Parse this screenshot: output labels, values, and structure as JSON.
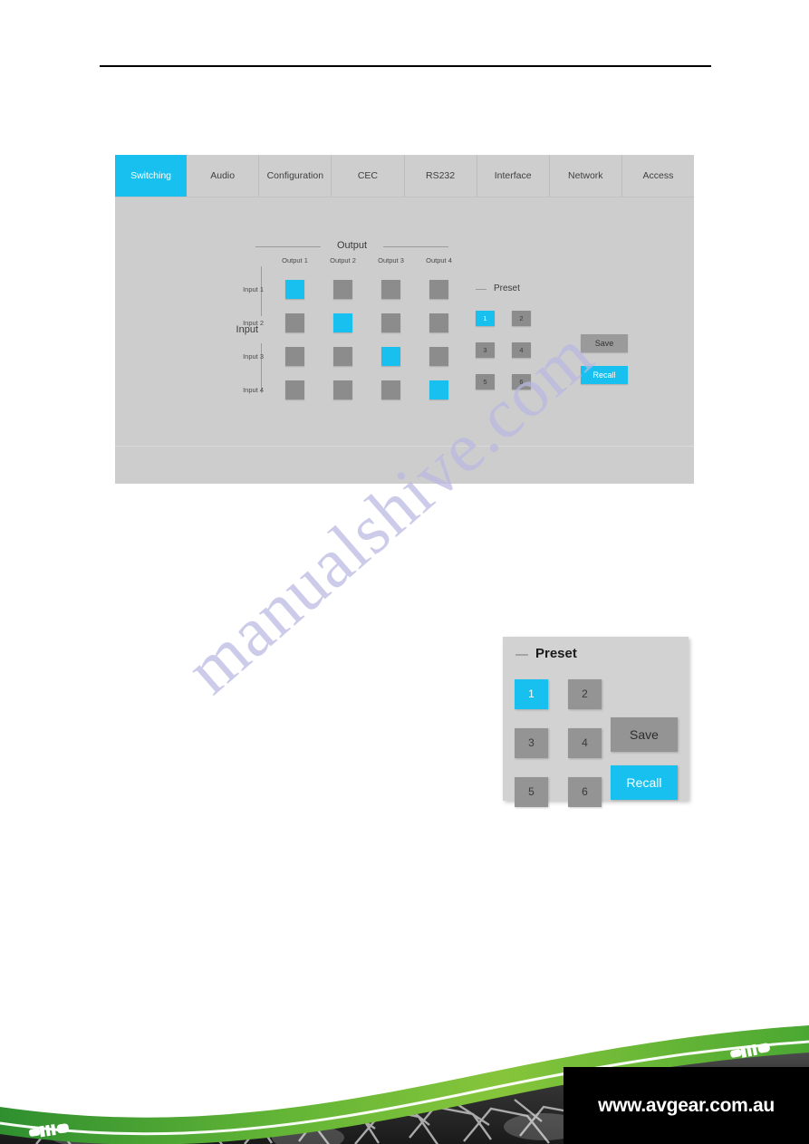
{
  "matrix_ui": {
    "tabs": [
      {
        "label": "Switching",
        "active": true
      },
      {
        "label": "Audio",
        "active": false
      },
      {
        "label": "Configuration",
        "active": false
      },
      {
        "label": "CEC",
        "active": false
      },
      {
        "label": "RS232",
        "active": false
      },
      {
        "label": "Interface",
        "active": false
      },
      {
        "label": "Network",
        "active": false
      },
      {
        "label": "Access",
        "active": false
      }
    ],
    "output_group_label": "Output",
    "input_group_label": "Input",
    "column_headers": [
      "Output 1",
      "Output 2",
      "Output 3",
      "Output 4"
    ],
    "row_headers": [
      "Input 1",
      "Input 2",
      "Input 3",
      "Input 4"
    ],
    "routing": [
      [
        true,
        false,
        false,
        false
      ],
      [
        false,
        true,
        false,
        false
      ],
      [
        false,
        false,
        true,
        false
      ],
      [
        false,
        false,
        false,
        true
      ]
    ],
    "preset": {
      "title": "Preset",
      "buttons": [
        {
          "label": "1",
          "selected": true
        },
        {
          "label": "2",
          "selected": false
        },
        {
          "label": "3",
          "selected": false
        },
        {
          "label": "4",
          "selected": false
        },
        {
          "label": "5",
          "selected": false
        },
        {
          "label": "6",
          "selected": false
        }
      ],
      "save_label": "Save",
      "recall_label": "Recall",
      "save_active": false,
      "recall_active": true
    }
  },
  "preset_detail": {
    "title": "Preset",
    "buttons": [
      {
        "label": "1",
        "selected": true
      },
      {
        "label": "2",
        "selected": false
      },
      {
        "label": "3",
        "selected": false
      },
      {
        "label": "4",
        "selected": false
      },
      {
        "label": "5",
        "selected": false
      },
      {
        "label": "6",
        "selected": false
      }
    ],
    "save_label": "Save",
    "recall_label": "Recall"
  },
  "watermark": {
    "text": "manualshive.com"
  },
  "footer": {
    "url": "www.avgear.com.au"
  },
  "colors": {
    "accent_blue": "#18c0f0",
    "button_gray": "#8c8c8c",
    "panel_gray": "#cdcdcd",
    "brand_green": "#4aa832",
    "footer_black": "#000000"
  }
}
